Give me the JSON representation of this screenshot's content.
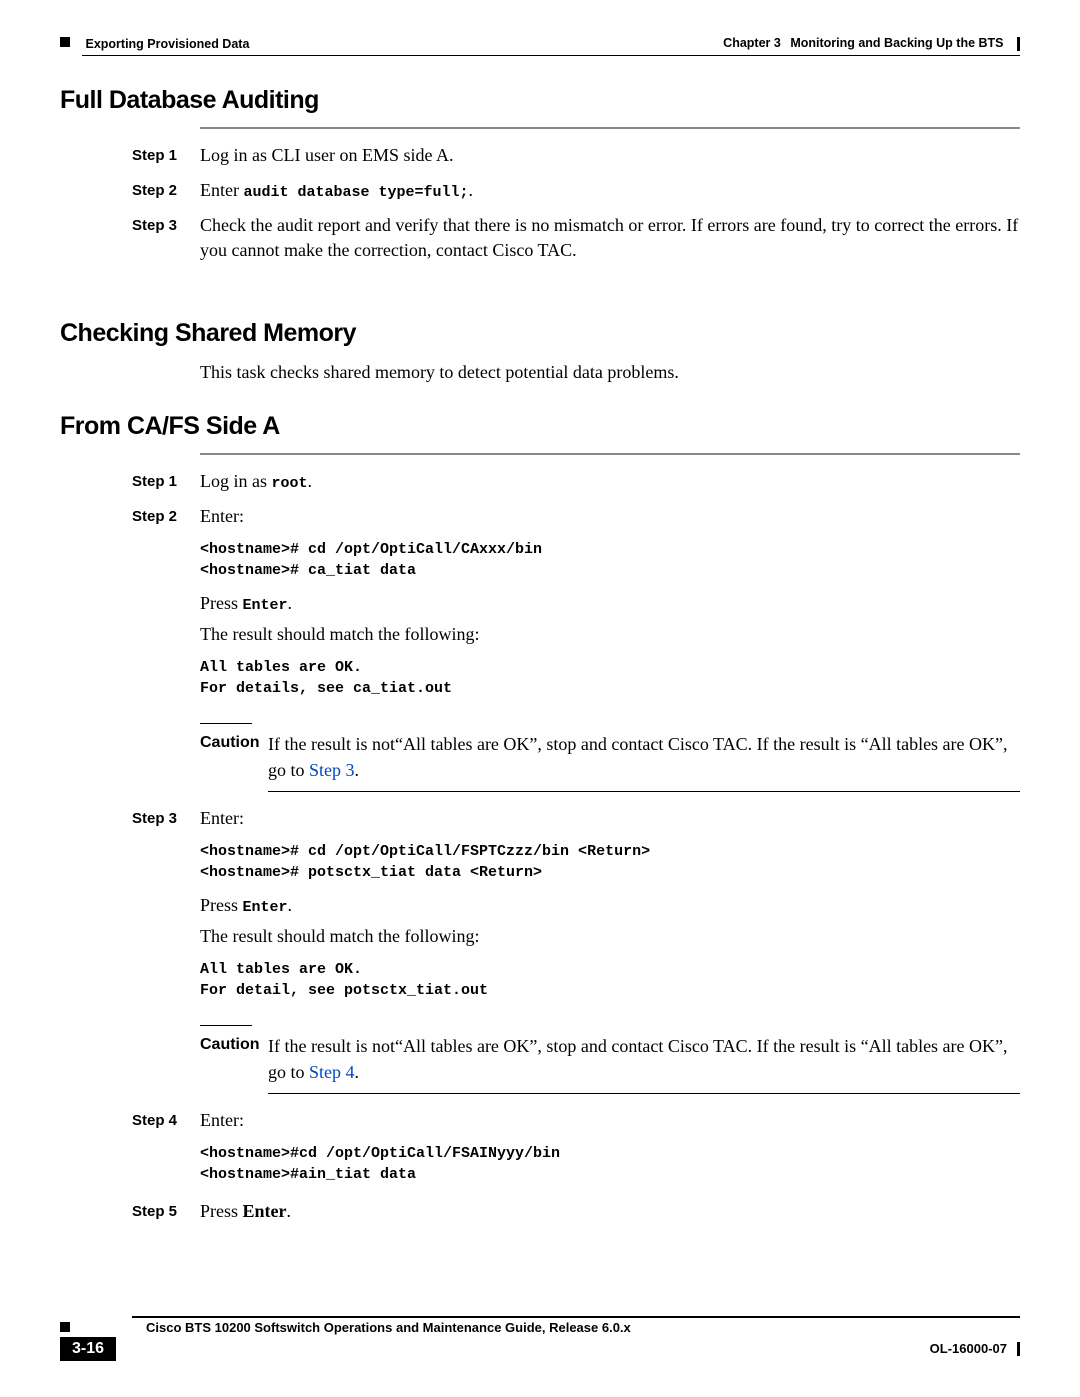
{
  "header": {
    "left_section": "Exporting Provisioned Data",
    "right_chapter_label": "Chapter 3",
    "right_chapter_title": "Monitoring and Backing Up the BTS"
  },
  "sections": {
    "full_db": {
      "title": "Full Database Auditing",
      "steps": {
        "s1": {
          "label": "Step 1",
          "text": "Log in as CLI user on EMS side A."
        },
        "s2": {
          "label": "Step 2",
          "prefix": "Enter ",
          "code": "audit database type=full;",
          "suffix": "."
        },
        "s3": {
          "label": "Step 3",
          "text": "Check the audit report and verify that there is no mismatch or error. If errors are found, try to correct the errors. If you cannot make the correction, contact Cisco TAC."
        }
      }
    },
    "shared_mem": {
      "title": "Checking Shared Memory",
      "intro": "This task checks shared memory to detect potential data problems."
    },
    "cafs": {
      "title": "From CA/FS Side A",
      "steps": {
        "s1": {
          "label": "Step 1",
          "prefix": "Log in as ",
          "code": "root",
          "suffix": "."
        },
        "s2": {
          "label": "Step 2",
          "enter": "Enter:",
          "code_block": "<hostname># cd /opt/OptiCall/CAxxx/bin\n<hostname># ca_tiat data",
          "press_prefix": "Press ",
          "press_code": "Enter",
          "press_suffix": ".",
          "result_intro": "The result should match the following:",
          "result_block": "All tables are OK.\nFor details, see ca_tiat.out"
        },
        "caution1": {
          "label": "Caution",
          "text_before": "If the result is not“All tables are OK”, stop and contact Cisco TAC. If the result is “All tables are OK”, go to ",
          "link": "Step 3",
          "text_after": "."
        },
        "s3": {
          "label": "Step 3",
          "enter": "Enter:",
          "code_block": "<hostname># cd /opt/OptiCall/FSPTCzzz/bin <Return>\n<hostname># potsctx_tiat data <Return>",
          "press_prefix": "Press ",
          "press_code": "Enter",
          "press_suffix": ".",
          "result_intro": "The result should match the following:",
          "result_block": "All tables are OK.\nFor detail, see potsctx_tiat.out"
        },
        "caution2": {
          "label": "Caution",
          "text_before": "If the result is not“All tables are OK”, stop and contact Cisco TAC. If the result is “All tables are OK”, go to ",
          "link": "Step 4",
          "text_after": "."
        },
        "s4": {
          "label": "Step 4",
          "enter": "Enter:",
          "code_block": "<hostname>#cd /opt/OptiCall/FSAINyyy/bin\n<hostname>#ain_tiat data"
        },
        "s5": {
          "label": "Step 5",
          "prefix": "Press ",
          "bold": "Enter",
          "suffix": "."
        }
      }
    }
  },
  "footer": {
    "doc_title": "Cisco BTS 10200 Softswitch Operations and Maintenance Guide, Release 6.0.x",
    "page_num": "3-16",
    "doc_id": "OL-16000-07"
  }
}
